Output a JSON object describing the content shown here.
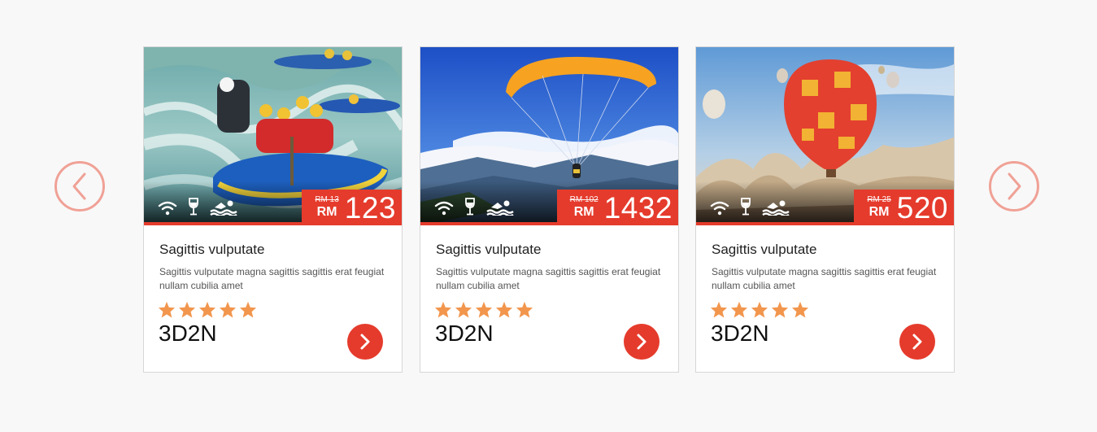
{
  "nav": {
    "prev_icon": "chevron-left-icon",
    "next_icon": "chevron-right-icon",
    "accent": "#f0a196"
  },
  "colors": {
    "accent_red": "#e53b2c",
    "star_orange": "#f2964d"
  },
  "cards": [
    {
      "image": "whitewater-rafting",
      "amenities": [
        "wifi-icon",
        "wine-glass-icon",
        "swimming-icon"
      ],
      "old_price": "RM 13",
      "currency": "RM",
      "price": "123",
      "title": "Sagittis vulputate",
      "description": "Sagittis vulputate magna sagittis sagittis erat feugiat nullam cubilia amet",
      "rating": 5,
      "duration": "3D2N"
    },
    {
      "image": "paragliding",
      "amenities": [
        "wifi-icon",
        "wine-glass-icon",
        "swimming-icon"
      ],
      "old_price": "RM 102",
      "currency": "RM",
      "price": "1432",
      "title": "Sagittis vulputate",
      "description": "Sagittis vulputate magna sagittis sagittis erat feugiat nullam cubilia amet",
      "rating": 5,
      "duration": "3D2N"
    },
    {
      "image": "hot-air-balloon",
      "amenities": [
        "wifi-icon",
        "wine-glass-icon",
        "swimming-icon"
      ],
      "old_price": "RM 25",
      "currency": "RM",
      "price": "520",
      "title": "Sagittis vulputate",
      "description": "Sagittis vulputate magna sagittis sagittis erat feugiat nullam cubilia amet",
      "rating": 5,
      "duration": "3D2N"
    }
  ]
}
